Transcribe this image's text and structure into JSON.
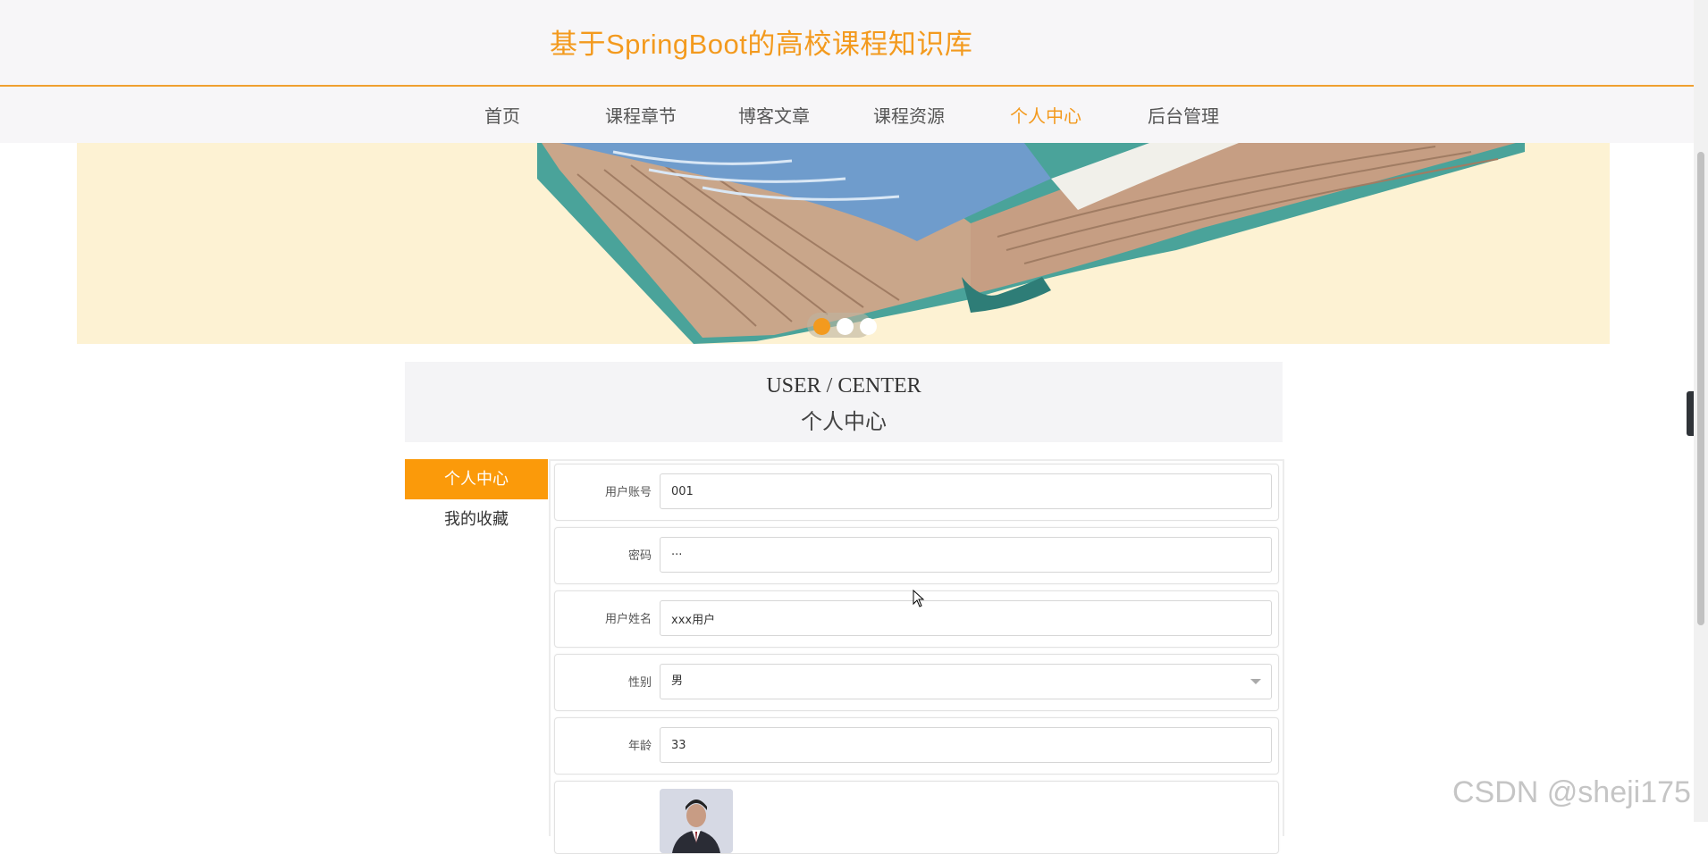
{
  "header": {
    "title": "基于SpringBoot的高校课程知识库"
  },
  "nav": {
    "items": [
      {
        "label": "首页"
      },
      {
        "label": "课程章节"
      },
      {
        "label": "博客文章"
      },
      {
        "label": "课程资源"
      },
      {
        "label": "个人中心",
        "active": true
      },
      {
        "label": "后台管理"
      }
    ]
  },
  "carousel": {
    "slide_count": 3,
    "active_index": 0
  },
  "section": {
    "title_en": "USER / CENTER",
    "title_cn": "个人中心"
  },
  "sidebar": {
    "items": [
      {
        "label": "个人中心",
        "active": true
      },
      {
        "label": "我的收藏"
      }
    ]
  },
  "form": {
    "account": {
      "label": "用户账号",
      "value": "001"
    },
    "password": {
      "label": "密码",
      "value": "···"
    },
    "name": {
      "label": "用户姓名",
      "value": "xxx用户"
    },
    "gender": {
      "label": "性别",
      "value": "男"
    },
    "age": {
      "label": "年龄",
      "value": "33"
    }
  },
  "side_tab": {
    "icon": "chevron-left-icon",
    "glyph": "‹"
  },
  "watermark": "CSDN @sheji175",
  "colors": {
    "accent": "#f39a1e",
    "sidebar_active": "#fb9a0a"
  }
}
